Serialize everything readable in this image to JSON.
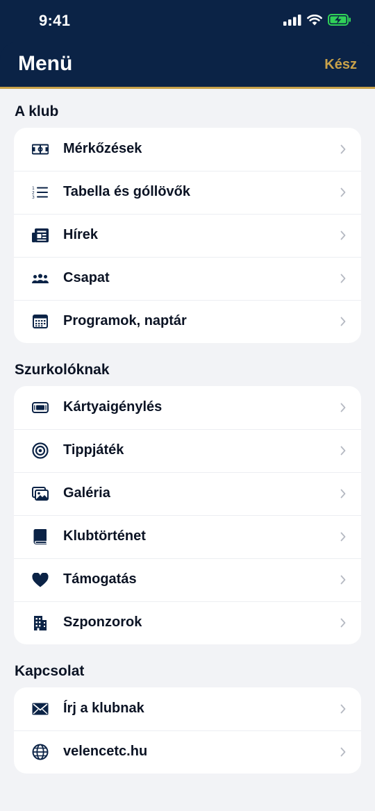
{
  "status_bar": {
    "time": "9:41"
  },
  "header": {
    "title": "Menü",
    "done_label": "Kész"
  },
  "colors": {
    "navy": "#0b2346",
    "gold": "#c9a24a",
    "battery": "#30d158"
  },
  "sections": [
    {
      "title": "A klub",
      "items": [
        {
          "label": "Mérkőzések",
          "icon": "pitch-icon"
        },
        {
          "label": "Tabella és góllövők",
          "icon": "numbered-list-icon"
        },
        {
          "label": "Hírek",
          "icon": "newspaper-icon"
        },
        {
          "label": "Csapat",
          "icon": "team-icon"
        },
        {
          "label": "Programok, naptár",
          "icon": "calendar-icon"
        }
      ]
    },
    {
      "title": "Szurkolóknak",
      "items": [
        {
          "label": "Kártyaigénylés",
          "icon": "ticket-icon"
        },
        {
          "label": "Tippjáték",
          "icon": "target-icon"
        },
        {
          "label": "Galéria",
          "icon": "gallery-icon"
        },
        {
          "label": "Klubtörténet",
          "icon": "book-icon"
        },
        {
          "label": "Támogatás",
          "icon": "heart-icon"
        },
        {
          "label": "Szponzorok",
          "icon": "building-icon"
        }
      ]
    },
    {
      "title": "Kapcsolat",
      "items": [
        {
          "label": "Írj a klubnak",
          "icon": "envelope-icon"
        },
        {
          "label": "velencetc.hu",
          "icon": "globe-icon"
        }
      ]
    }
  ]
}
